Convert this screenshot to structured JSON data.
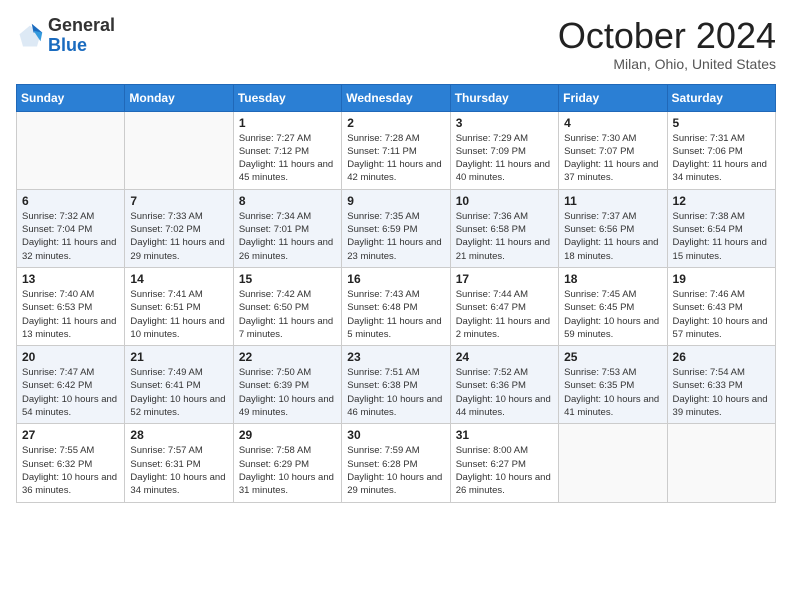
{
  "logo": {
    "general": "General",
    "blue": "Blue"
  },
  "title": "October 2024",
  "subtitle": "Milan, Ohio, United States",
  "weekdays": [
    "Sunday",
    "Monday",
    "Tuesday",
    "Wednesday",
    "Thursday",
    "Friday",
    "Saturday"
  ],
  "weeks": [
    [
      {
        "day": null
      },
      {
        "day": null
      },
      {
        "day": "1",
        "sunrise": "Sunrise: 7:27 AM",
        "sunset": "Sunset: 7:12 PM",
        "daylight": "Daylight: 11 hours and 45 minutes."
      },
      {
        "day": "2",
        "sunrise": "Sunrise: 7:28 AM",
        "sunset": "Sunset: 7:11 PM",
        "daylight": "Daylight: 11 hours and 42 minutes."
      },
      {
        "day": "3",
        "sunrise": "Sunrise: 7:29 AM",
        "sunset": "Sunset: 7:09 PM",
        "daylight": "Daylight: 11 hours and 40 minutes."
      },
      {
        "day": "4",
        "sunrise": "Sunrise: 7:30 AM",
        "sunset": "Sunset: 7:07 PM",
        "daylight": "Daylight: 11 hours and 37 minutes."
      },
      {
        "day": "5",
        "sunrise": "Sunrise: 7:31 AM",
        "sunset": "Sunset: 7:06 PM",
        "daylight": "Daylight: 11 hours and 34 minutes."
      }
    ],
    [
      {
        "day": "6",
        "sunrise": "Sunrise: 7:32 AM",
        "sunset": "Sunset: 7:04 PM",
        "daylight": "Daylight: 11 hours and 32 minutes."
      },
      {
        "day": "7",
        "sunrise": "Sunrise: 7:33 AM",
        "sunset": "Sunset: 7:02 PM",
        "daylight": "Daylight: 11 hours and 29 minutes."
      },
      {
        "day": "8",
        "sunrise": "Sunrise: 7:34 AM",
        "sunset": "Sunset: 7:01 PM",
        "daylight": "Daylight: 11 hours and 26 minutes."
      },
      {
        "day": "9",
        "sunrise": "Sunrise: 7:35 AM",
        "sunset": "Sunset: 6:59 PM",
        "daylight": "Daylight: 11 hours and 23 minutes."
      },
      {
        "day": "10",
        "sunrise": "Sunrise: 7:36 AM",
        "sunset": "Sunset: 6:58 PM",
        "daylight": "Daylight: 11 hours and 21 minutes."
      },
      {
        "day": "11",
        "sunrise": "Sunrise: 7:37 AM",
        "sunset": "Sunset: 6:56 PM",
        "daylight": "Daylight: 11 hours and 18 minutes."
      },
      {
        "day": "12",
        "sunrise": "Sunrise: 7:38 AM",
        "sunset": "Sunset: 6:54 PM",
        "daylight": "Daylight: 11 hours and 15 minutes."
      }
    ],
    [
      {
        "day": "13",
        "sunrise": "Sunrise: 7:40 AM",
        "sunset": "Sunset: 6:53 PM",
        "daylight": "Daylight: 11 hours and 13 minutes."
      },
      {
        "day": "14",
        "sunrise": "Sunrise: 7:41 AM",
        "sunset": "Sunset: 6:51 PM",
        "daylight": "Daylight: 11 hours and 10 minutes."
      },
      {
        "day": "15",
        "sunrise": "Sunrise: 7:42 AM",
        "sunset": "Sunset: 6:50 PM",
        "daylight": "Daylight: 11 hours and 7 minutes."
      },
      {
        "day": "16",
        "sunrise": "Sunrise: 7:43 AM",
        "sunset": "Sunset: 6:48 PM",
        "daylight": "Daylight: 11 hours and 5 minutes."
      },
      {
        "day": "17",
        "sunrise": "Sunrise: 7:44 AM",
        "sunset": "Sunset: 6:47 PM",
        "daylight": "Daylight: 11 hours and 2 minutes."
      },
      {
        "day": "18",
        "sunrise": "Sunrise: 7:45 AM",
        "sunset": "Sunset: 6:45 PM",
        "daylight": "Daylight: 10 hours and 59 minutes."
      },
      {
        "day": "19",
        "sunrise": "Sunrise: 7:46 AM",
        "sunset": "Sunset: 6:43 PM",
        "daylight": "Daylight: 10 hours and 57 minutes."
      }
    ],
    [
      {
        "day": "20",
        "sunrise": "Sunrise: 7:47 AM",
        "sunset": "Sunset: 6:42 PM",
        "daylight": "Daylight: 10 hours and 54 minutes."
      },
      {
        "day": "21",
        "sunrise": "Sunrise: 7:49 AM",
        "sunset": "Sunset: 6:41 PM",
        "daylight": "Daylight: 10 hours and 52 minutes."
      },
      {
        "day": "22",
        "sunrise": "Sunrise: 7:50 AM",
        "sunset": "Sunset: 6:39 PM",
        "daylight": "Daylight: 10 hours and 49 minutes."
      },
      {
        "day": "23",
        "sunrise": "Sunrise: 7:51 AM",
        "sunset": "Sunset: 6:38 PM",
        "daylight": "Daylight: 10 hours and 46 minutes."
      },
      {
        "day": "24",
        "sunrise": "Sunrise: 7:52 AM",
        "sunset": "Sunset: 6:36 PM",
        "daylight": "Daylight: 10 hours and 44 minutes."
      },
      {
        "day": "25",
        "sunrise": "Sunrise: 7:53 AM",
        "sunset": "Sunset: 6:35 PM",
        "daylight": "Daylight: 10 hours and 41 minutes."
      },
      {
        "day": "26",
        "sunrise": "Sunrise: 7:54 AM",
        "sunset": "Sunset: 6:33 PM",
        "daylight": "Daylight: 10 hours and 39 minutes."
      }
    ],
    [
      {
        "day": "27",
        "sunrise": "Sunrise: 7:55 AM",
        "sunset": "Sunset: 6:32 PM",
        "daylight": "Daylight: 10 hours and 36 minutes."
      },
      {
        "day": "28",
        "sunrise": "Sunrise: 7:57 AM",
        "sunset": "Sunset: 6:31 PM",
        "daylight": "Daylight: 10 hours and 34 minutes."
      },
      {
        "day": "29",
        "sunrise": "Sunrise: 7:58 AM",
        "sunset": "Sunset: 6:29 PM",
        "daylight": "Daylight: 10 hours and 31 minutes."
      },
      {
        "day": "30",
        "sunrise": "Sunrise: 7:59 AM",
        "sunset": "Sunset: 6:28 PM",
        "daylight": "Daylight: 10 hours and 29 minutes."
      },
      {
        "day": "31",
        "sunrise": "Sunrise: 8:00 AM",
        "sunset": "Sunset: 6:27 PM",
        "daylight": "Daylight: 10 hours and 26 minutes."
      },
      {
        "day": null
      },
      {
        "day": null
      }
    ]
  ]
}
